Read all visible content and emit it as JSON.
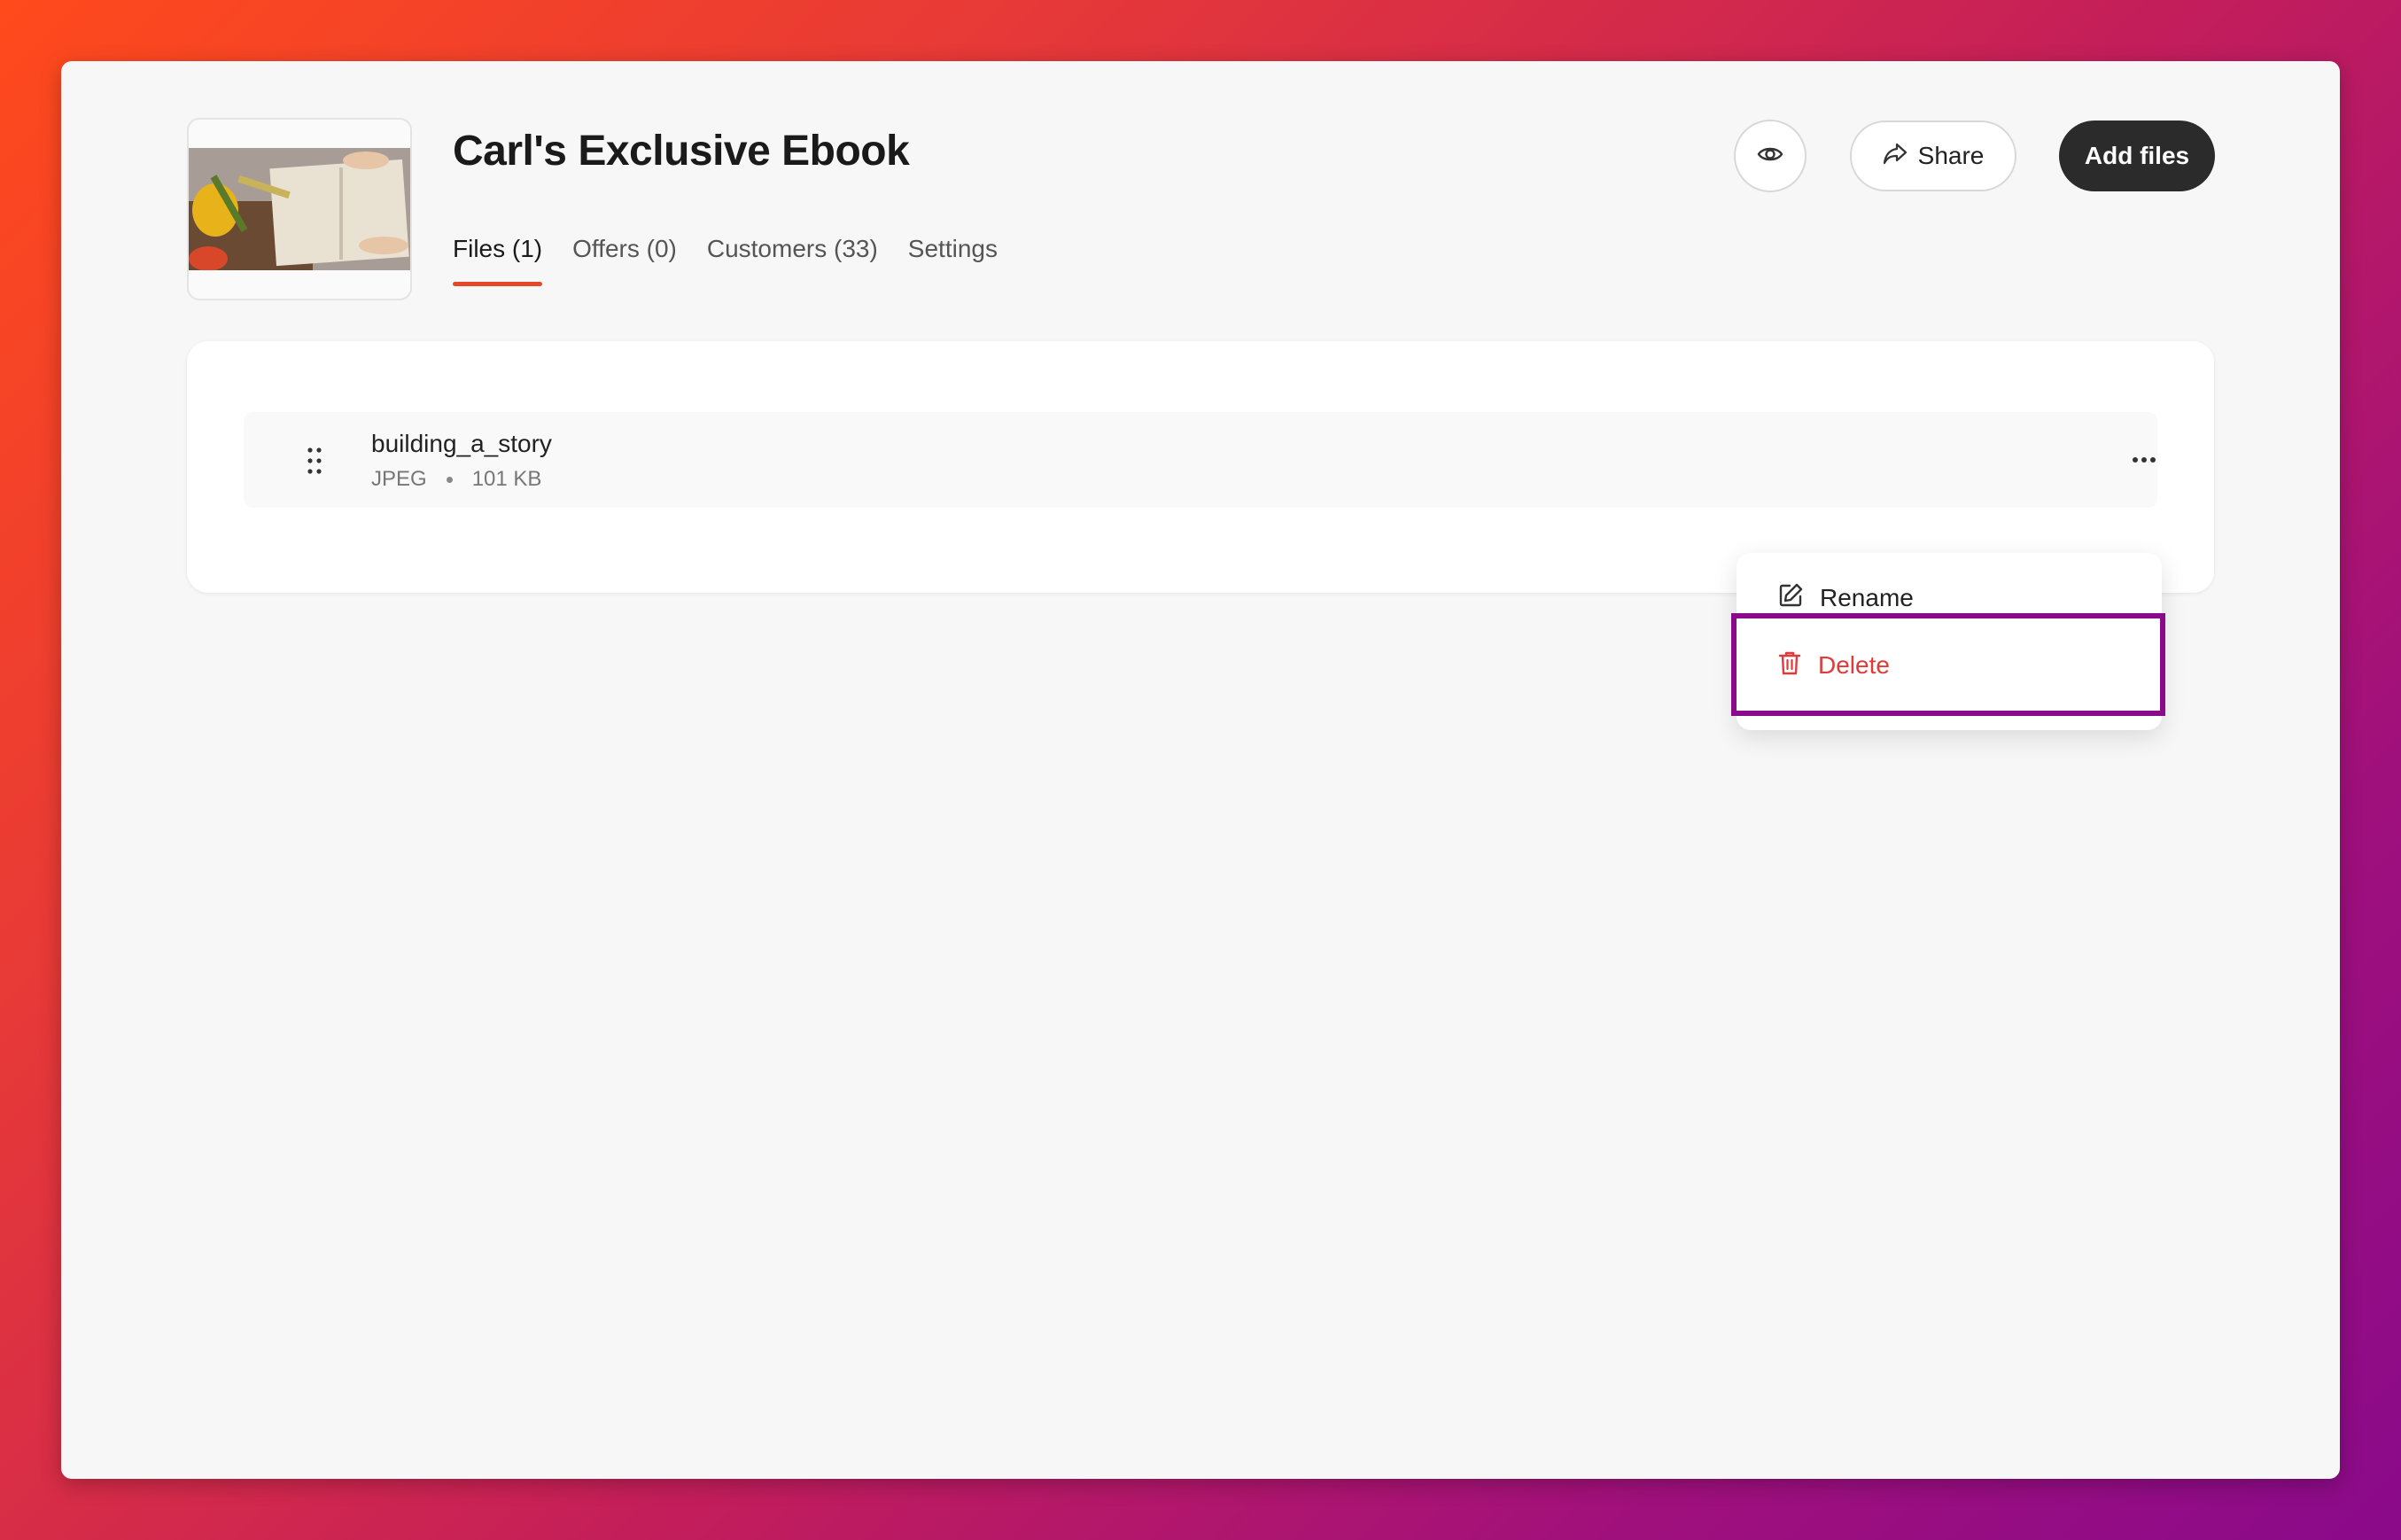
{
  "product": {
    "title": "Carl's Exclusive Ebook"
  },
  "tabs": [
    {
      "label": "Files (1)",
      "active": true
    },
    {
      "label": "Offers (0)",
      "active": false
    },
    {
      "label": "Customers (33)",
      "active": false
    },
    {
      "label": "Settings",
      "active": false
    }
  ],
  "header": {
    "preview_icon": "eye-icon",
    "share_label": "Share",
    "share_icon": "share-arrow-icon",
    "add_files_label": "Add files"
  },
  "files": [
    {
      "name": "building_a_story",
      "type": "JPEG",
      "size": "101 KB"
    }
  ],
  "context_menu": {
    "rename_label": "Rename",
    "rename_icon": "pencil-icon",
    "delete_label": "Delete",
    "delete_icon": "trash-icon"
  },
  "colors": {
    "accent": "#e6472b",
    "danger": "#e03a3a",
    "primary_button": "#2b2b2b",
    "highlight": "#8b0a8b"
  }
}
